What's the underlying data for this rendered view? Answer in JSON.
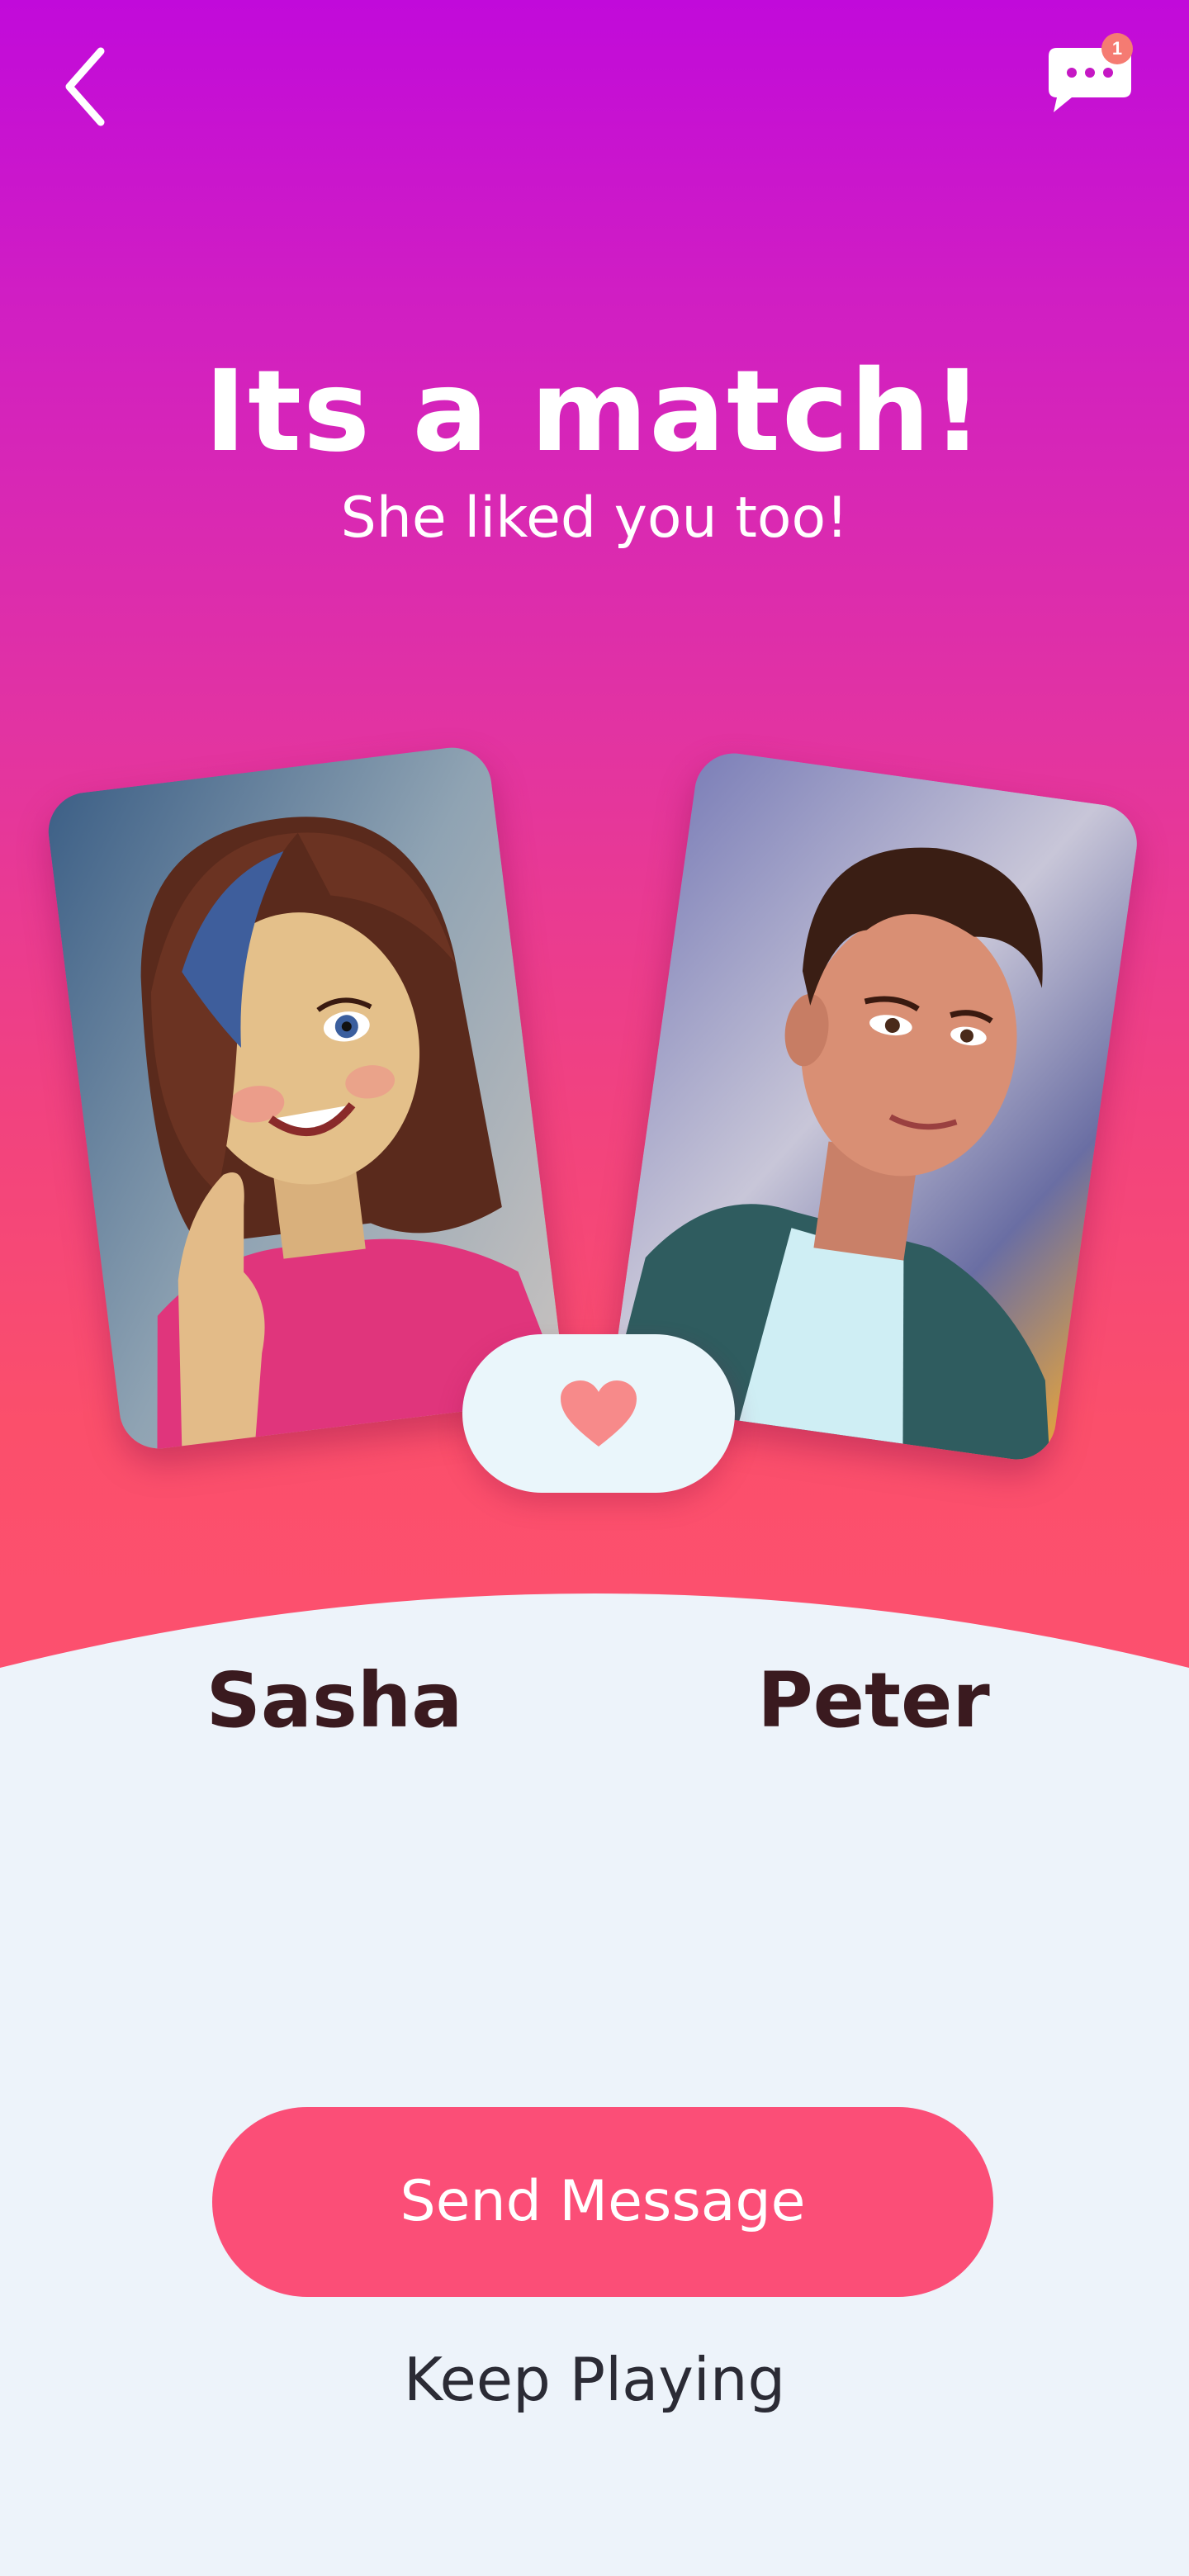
{
  "header": {
    "back_icon": "chevron-left-icon",
    "chat_icon": "chat-bubble-icon",
    "chat_badge_count": "1"
  },
  "match": {
    "title": "Its a match!",
    "subtitle": "She liked you too!",
    "heart_icon": "heart-icon"
  },
  "profiles": [
    {
      "name": "Sasha"
    },
    {
      "name": "Peter"
    }
  ],
  "actions": {
    "send_message_label": "Send Message",
    "keep_playing_label": "Keep Playing"
  },
  "colors": {
    "gradient_top": "#c10ada",
    "gradient_bottom": "#fd5070",
    "accent": "#fb4e77",
    "background": "#edf3fa",
    "name_text": "#3a1a1f",
    "heart": "#f78a8a"
  }
}
